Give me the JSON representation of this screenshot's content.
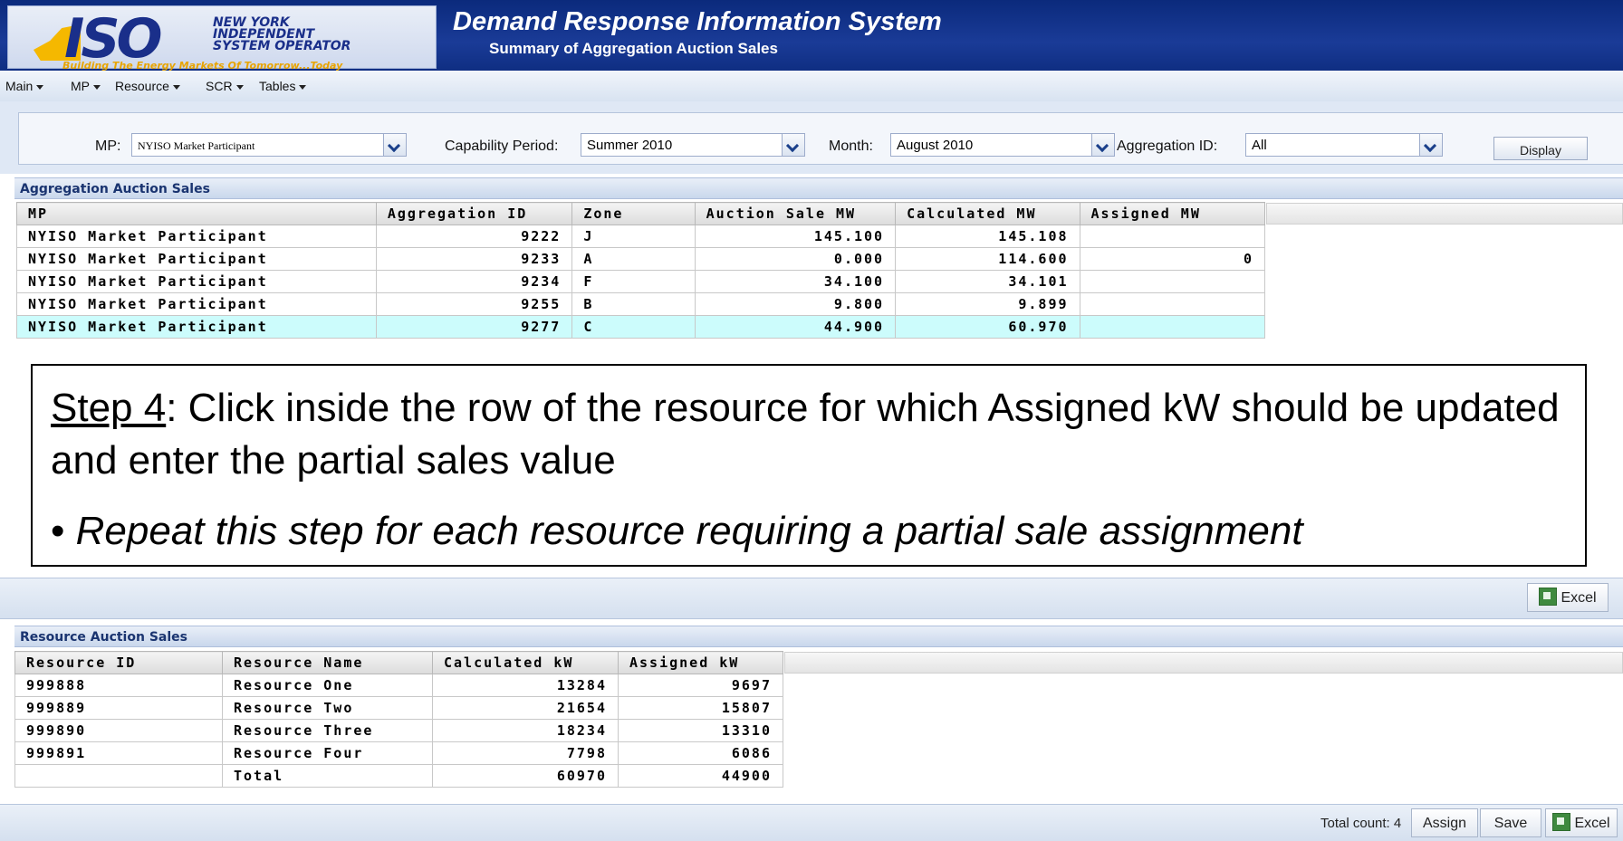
{
  "header": {
    "logo_iso": "ISO",
    "logo_name": [
      "NEW YORK",
      "INDEPENDENT",
      "SYSTEM OPERATOR"
    ],
    "logo_tagline": "Building The Energy Markets Of Tomorrow...Today",
    "title": "Demand Response Information System",
    "subtitle": "Summary of Aggregation Auction Sales"
  },
  "menu": [
    "Main",
    "MP",
    "Resource",
    "SCR",
    "Tables"
  ],
  "filters": {
    "mp_label": "MP:",
    "mp_value": "NYISO Market Participant",
    "capability_label": "Capability Period:",
    "capability_value": "Summer 2010",
    "month_label": "Month:",
    "month_value": "August 2010",
    "aggregation_label": "Aggregation ID:",
    "aggregation_value": "All",
    "display_label": "Display"
  },
  "aggregation": {
    "title": "Aggregation Auction Sales",
    "columns": [
      "MP",
      "Aggregation ID",
      "Zone",
      "Auction Sale MW",
      "Calculated MW",
      "Assigned MW"
    ],
    "rows": [
      [
        "NYISO Market Participant",
        "9222",
        "J",
        "145.100",
        "145.108",
        ""
      ],
      [
        "NYISO Market Participant",
        "9233",
        "A",
        "0.000",
        "114.600",
        "0"
      ],
      [
        "NYISO Market Participant",
        "9234",
        "F",
        "34.100",
        "34.101",
        ""
      ],
      [
        "NYISO Market Participant",
        "9255",
        "B",
        "9.800",
        "9.899",
        ""
      ],
      [
        "NYISO Market Participant",
        "9277",
        "C",
        "44.900",
        "60.970",
        ""
      ]
    ],
    "selected_row": 4
  },
  "callout": {
    "step_label": "Step 4",
    "step_text": ": Click inside the row of the resource for which Assigned kW should be updated and enter the partial sales value",
    "bullet": "•",
    "bullet_text": "Repeat this step for each resource requiring a partial sale assignment"
  },
  "toolbar_mid": {
    "excel_label": "Excel"
  },
  "resource": {
    "title": "Resource Auction Sales",
    "columns": [
      "Resource ID",
      "Resource Name",
      "Calculated kW",
      "Assigned kW"
    ],
    "rows": [
      [
        "999888",
        "Resource One",
        "13284",
        "9697"
      ],
      [
        "999889",
        "Resource Two",
        "21654",
        "15807"
      ],
      [
        "999890",
        "Resource Three",
        "18234",
        "13310"
      ],
      [
        "999891",
        "Resource Four",
        "7798",
        "6086"
      ],
      [
        "",
        "Total",
        "60970",
        "44900"
      ]
    ]
  },
  "toolbar_bottom": {
    "total_count": "Total count: 4",
    "assign_label": "Assign",
    "save_label": "Save",
    "excel_label": "Excel"
  },
  "colors": {
    "header_blue": "#0b2a7c",
    "selected_row": "#ccfcfc",
    "logo_gold": "#f5b800"
  }
}
